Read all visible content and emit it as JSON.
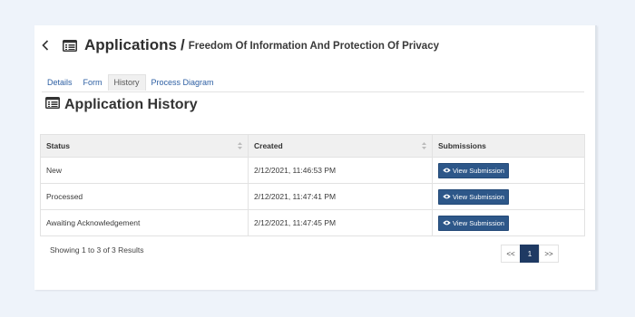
{
  "header": {
    "title": "Applications",
    "separator": "/",
    "subtitle": "Freedom Of Information And Protection Of Privacy"
  },
  "icons": {
    "back": "chevron-left-icon",
    "app": "list-alt-icon",
    "eye": "eye-icon",
    "sort": "sort-icon"
  },
  "tabs": [
    {
      "label": "Details",
      "active": false
    },
    {
      "label": "Form",
      "active": false
    },
    {
      "label": "History",
      "active": true
    },
    {
      "label": "Process Diagram",
      "active": false
    }
  ],
  "section": {
    "title": "Application History"
  },
  "table": {
    "columns": [
      "Status",
      "Created",
      "Submissions"
    ],
    "rows": [
      {
        "status": "New",
        "created": "2/12/2021, 11:46:53 PM",
        "action": "View Submission"
      },
      {
        "status": "Processed",
        "created": "2/12/2021, 11:47:41 PM",
        "action": "View Submission"
      },
      {
        "status": "Awaiting Acknowledgement",
        "created": "2/12/2021, 11:47:45 PM",
        "action": "View Submission"
      }
    ]
  },
  "footer": {
    "summary": "Showing 1 to 3 of 3 Results",
    "pagination": {
      "prev": "<<",
      "current": "1",
      "next": ">>"
    }
  },
  "colors": {
    "accent": "#2d5789",
    "active_page": "#1f3a63",
    "link": "#2d5fa3",
    "background": "#eef3fa"
  }
}
